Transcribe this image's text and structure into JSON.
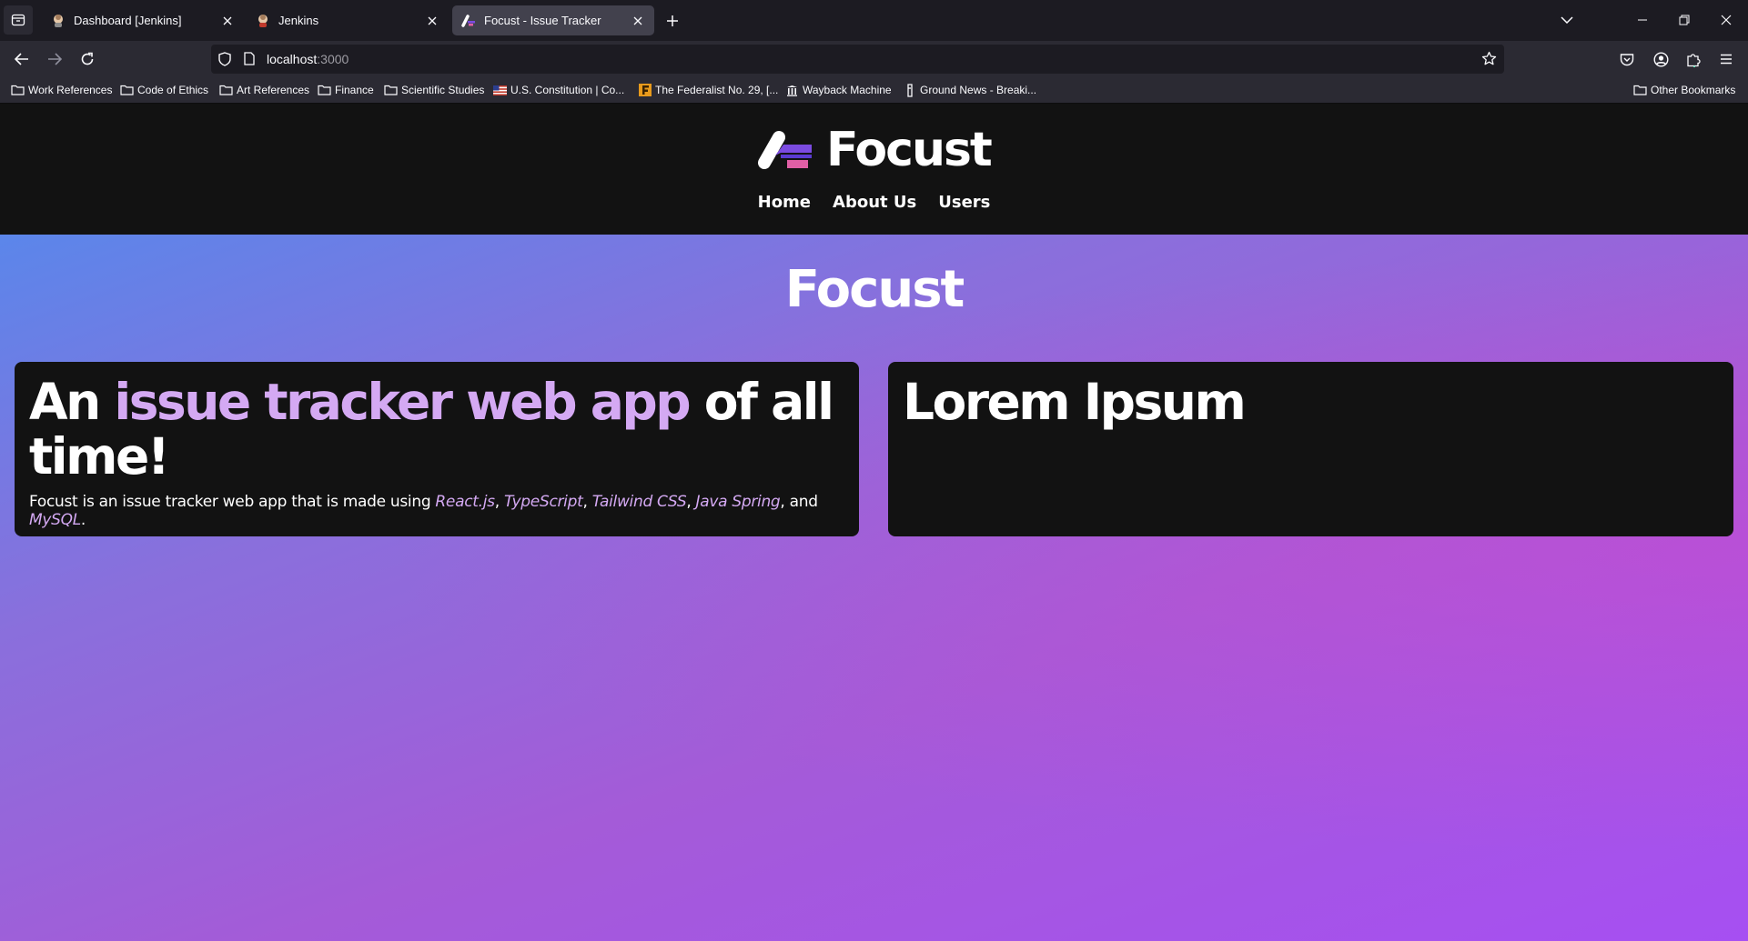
{
  "browser": {
    "tabs": [
      {
        "title": "Dashboard [Jenkins]",
        "favicon": "jenkins-icon",
        "active": false
      },
      {
        "title": "Jenkins",
        "favicon": "jenkins-icon",
        "active": false
      },
      {
        "title": "Focust - Issue Tracker",
        "favicon": "focust-logo-icon",
        "active": true
      }
    ],
    "url": {
      "host": "localhost",
      "port": ":3000"
    },
    "bookmarks": [
      {
        "label": "Work References",
        "icon": "folder-icon"
      },
      {
        "label": "Code of Ethics",
        "icon": "folder-icon"
      },
      {
        "label": "Art References",
        "icon": "folder-icon"
      },
      {
        "label": "Finance",
        "icon": "folder-icon"
      },
      {
        "label": "Scientific Studies",
        "icon": "folder-icon"
      },
      {
        "label": "U.S. Constitution | Co...",
        "icon": "us-flag-icon"
      },
      {
        "label": "The Federalist No. 29, [...",
        "icon": "federalist-f-icon"
      },
      {
        "label": "Wayback Machine",
        "icon": "wayback-icon"
      },
      {
        "label": "Ground News - Breaki...",
        "icon": "ground-news-icon"
      }
    ],
    "other_bookmarks": "Other Bookmarks"
  },
  "site": {
    "brand": "Focust",
    "nav": [
      "Home",
      "About Us",
      "Users"
    ],
    "hero_title": "Focust",
    "card_left": {
      "heading_pre": "An ",
      "heading_highlight": "issue tracker web app",
      "heading_post": " of all time!",
      "desc_pre": "Focust is an issue tracker web app that is made using ",
      "tech": [
        "React.js",
        "TypeScript",
        "Tailwind CSS",
        "Java Spring",
        "MySQL"
      ],
      "sep1": ", ",
      "sep2": ", ",
      "sep3": ", ",
      "sep4": ", and ",
      "desc_end": "."
    },
    "card_right": {
      "heading": "Lorem Ipsum"
    }
  },
  "colors": {
    "accent": "#d4a9f3",
    "header_bg": "#121212",
    "gradient_start": "#5b86ea",
    "gradient_end": "#a64ff2"
  }
}
